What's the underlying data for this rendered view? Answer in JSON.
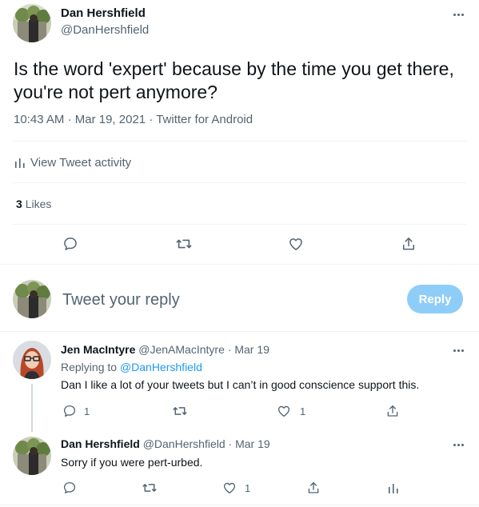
{
  "main_tweet": {
    "author_name": "Dan Hershfield",
    "handle": "@DanHershfield",
    "text_line1": "Is the word 'expert' because by the time you get there,",
    "text_line2": "you're not pert anymore?",
    "time": "10:43 AM",
    "date": "Mar 19, 2021",
    "source": "Twitter for Android",
    "sep": "·",
    "activity_label": "View Tweet activity",
    "likes_count": "3",
    "likes_label": "Likes"
  },
  "compose": {
    "placeholder": "Tweet your reply",
    "reply_button": "Reply"
  },
  "replies": [
    {
      "author_name": "Jen MacIntyre",
      "handle": "@JenAMacIntyre",
      "date": "Mar 19",
      "replying_prefix": "Replying to",
      "replying_to": "@DanHershfield",
      "text": "Dan I like a lot of your tweets but I can’t in good conscience support this.",
      "reply_count": "1",
      "like_count": "1"
    },
    {
      "author_name": "Dan Hershfield",
      "handle": "@DanHershfield",
      "date": "Mar 19",
      "text": "Sorry if you were pert-urbed.",
      "like_count": "1"
    }
  ],
  "colors": {
    "accent": "#1d9bf0",
    "reply_button_disabled": "#8ecdf8",
    "muted_text": "#536471"
  }
}
